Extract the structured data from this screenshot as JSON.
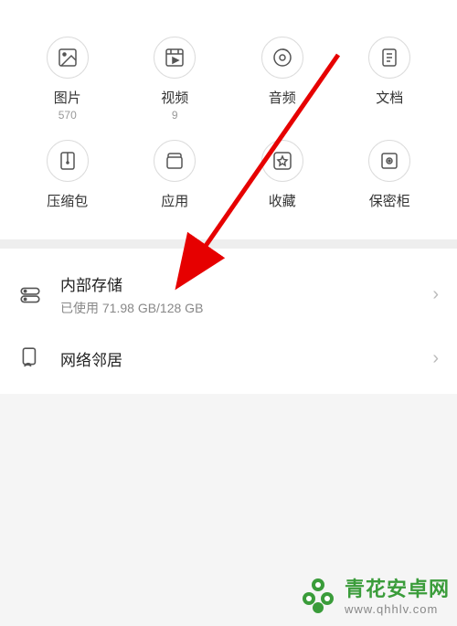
{
  "categories": [
    {
      "key": "images",
      "label": "图片",
      "count": "570"
    },
    {
      "key": "videos",
      "label": "视频",
      "count": "9"
    },
    {
      "key": "audio",
      "label": "音频",
      "count": ""
    },
    {
      "key": "docs",
      "label": "文档",
      "count": ""
    },
    {
      "key": "archives",
      "label": "压缩包",
      "count": ""
    },
    {
      "key": "apps",
      "label": "应用",
      "count": ""
    },
    {
      "key": "favorites",
      "label": "收藏",
      "count": ""
    },
    {
      "key": "safe",
      "label": "保密柜",
      "count": ""
    }
  ],
  "storage": {
    "internal": {
      "title": "内部存储",
      "subtitle": "已使用 71.98 GB/128 GB"
    },
    "network": {
      "title": "网络邻居"
    }
  },
  "watermark": {
    "title": "青花安卓网",
    "url": "www.qhhlv.com"
  }
}
